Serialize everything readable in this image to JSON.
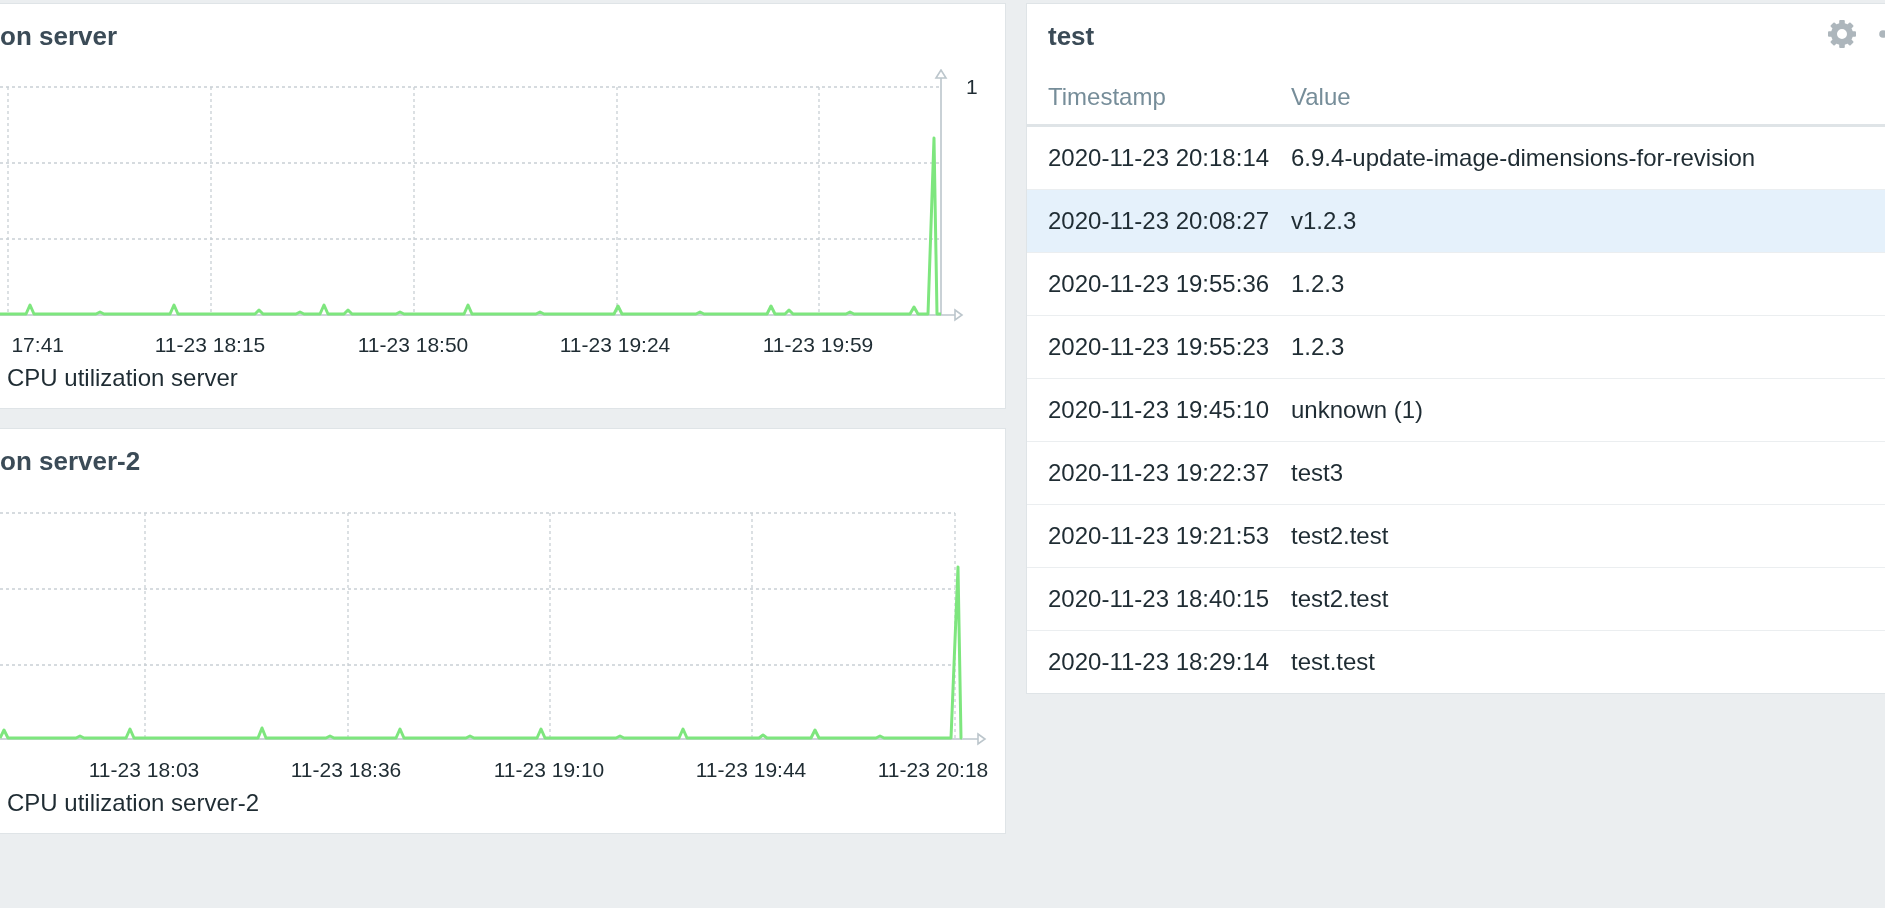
{
  "graphs": [
    {
      "title": "on server",
      "y_axis_label": "1",
      "x_labels": [
        "17:41",
        "11-23 18:15",
        "11-23 18:50",
        "11-23 19:24",
        "11-23 19:59"
      ],
      "legend": "CPU utilization server"
    },
    {
      "title": "on server-2",
      "x_labels": [
        "11-23 18:03",
        "11-23 18:36",
        "11-23 19:10",
        "11-23 19:44",
        "11-23 20:18"
      ],
      "legend": "CPU utilization server-2"
    }
  ],
  "history_widget": {
    "title": "test",
    "columns": [
      "Timestamp",
      "Value"
    ],
    "rows": [
      {
        "timestamp": "2020-11-23 20:18:14",
        "value": "6.9.4-update-image-dimensions-for-revision",
        "selected": false
      },
      {
        "timestamp": "2020-11-23 20:08:27",
        "value": "v1.2.3",
        "selected": true
      },
      {
        "timestamp": "2020-11-23 19:55:36",
        "value": "1.2.3",
        "selected": false
      },
      {
        "timestamp": "2020-11-23 19:55:23",
        "value": "1.2.3",
        "selected": false
      },
      {
        "timestamp": "2020-11-23 19:45:10",
        "value": "unknown (1)",
        "selected": false
      },
      {
        "timestamp": "2020-11-23 19:22:37",
        "value": "test3",
        "selected": false
      },
      {
        "timestamp": "2020-11-23 19:21:53",
        "value": "test2.test",
        "selected": false
      },
      {
        "timestamp": "2020-11-23 18:40:15",
        "value": "test2.test",
        "selected": false
      },
      {
        "timestamp": "2020-11-23 18:29:14",
        "value": "test.test",
        "selected": false
      }
    ]
  }
}
